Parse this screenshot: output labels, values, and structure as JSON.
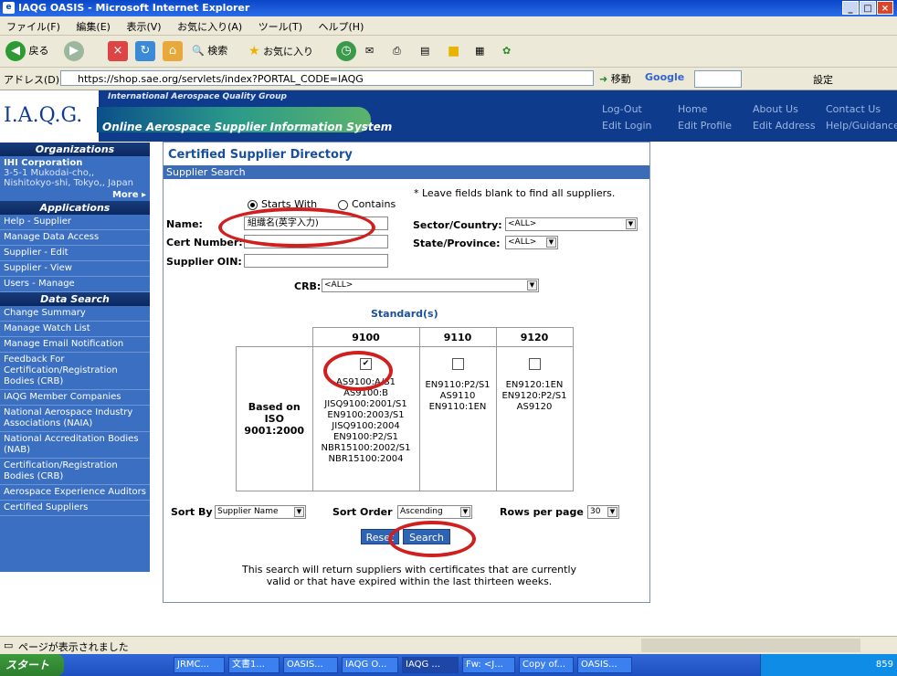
{
  "window": {
    "title": "IAQG OASIS - Microsoft Internet Explorer"
  },
  "menu": [
    "ファイル(F)",
    "編集(E)",
    "表示(V)",
    "お気に入り(A)",
    "ツール(T)",
    "ヘルプ(H)"
  ],
  "toolbar": {
    "back": "戻る",
    "search": "検索",
    "favorites": "お気に入り",
    "settings": "設定"
  },
  "address": {
    "label": "アドレス(D)",
    "url": "https://shop.sae.org/servlets/index?PORTAL_CODE=IAQG",
    "go": "移動",
    "google": "Google"
  },
  "header": {
    "logo": "I.A.Q.G.",
    "org": "International Aerospace Quality Group",
    "system": "Online Aerospace Supplier Information System",
    "links_row1": [
      "Log-Out",
      "Home",
      "About Us",
      "Contact Us"
    ],
    "links_row2": [
      "Edit Login",
      "Edit Profile",
      "Edit Address",
      "Help/Guidance"
    ]
  },
  "sidebar": {
    "org_heading": "Organizations",
    "org_name": "IHI Corporation",
    "org_addr": "3-5-1 Mukodai-cho,, Nishitokyo-shi, Tokyo,, Japan",
    "more": "More ▸",
    "apps_heading": "Applications",
    "apps": [
      "Help - Supplier",
      "Manage Data Access",
      "Supplier - Edit",
      "Supplier - View",
      "Users - Manage"
    ],
    "data_heading": "Data Search",
    "data": [
      "Change Summary",
      "Manage Watch List",
      "Manage Email Notification",
      "Feedback For Certification/Registration Bodies (CRB)",
      "IAQG Member Companies",
      "National Aerospace Industry Associations (NAIA)",
      "National Accreditation Bodies (NAB)",
      "Certification/Registration Bodies (CRB)",
      "Aerospace Experience Auditors",
      "Certified Suppliers"
    ]
  },
  "main": {
    "title": "Certified Supplier Directory",
    "panel": "Supplier Search",
    "hint": "* Leave fields blank to find all suppliers.",
    "starts_with": "Starts With",
    "contains": "Contains",
    "name_label": "Name:",
    "name_value": "組織名(英字入力)",
    "cert_label": "Cert Number:",
    "oin_label": "Supplier OIN:",
    "sector_label": "Sector/Country:",
    "sector_value": "<ALL>",
    "state_label": "State/Province:",
    "state_value": "<ALL>",
    "crb_label": "CRB:",
    "crb_value": "<ALL>",
    "standards_title": "Standard(s)",
    "std_cols": [
      "9100",
      "9110",
      "9120"
    ],
    "row_label": "Based on ISO 9001:2000",
    "std_9100": "AS9100:A/S1 AS9100:B JISQ9100:2001/S1 EN9100:2003/S1 JISQ9100:2004 EN9100:P2/S1 NBR15100:2002/S1 NBR15100:2004",
    "std_9110": "EN9110:P2/S1 AS9110 EN9110:1EN",
    "std_9120": "EN9120:1EN EN9120:P2/S1 AS9120",
    "sort_by_label": "Sort By",
    "sort_by_value": "Supplier Name",
    "sort_order_label": "Sort Order",
    "sort_order_value": "Ascending",
    "rows_label": "Rows per page",
    "rows_value": "30",
    "reset": "Reset",
    "search": "Search",
    "note": "This search will return suppliers with certificates that are currently valid or that have expired within the last thirteen weeks."
  },
  "status": {
    "text": "ページが表示されました"
  },
  "taskbar": {
    "start": "スタート",
    "tasks": [
      "JRMC...",
      "文書1...",
      "OASIS...",
      "IAQG O...",
      "IAQG ...",
      "Fw: <J...",
      "Copy of...",
      "OASIS..."
    ],
    "clock": "859"
  },
  "colors": {
    "header": "#0f3b8c",
    "sidebar": "#3a6fc2",
    "accent": "#2f63b4",
    "highlight": "#cf1f1f"
  }
}
